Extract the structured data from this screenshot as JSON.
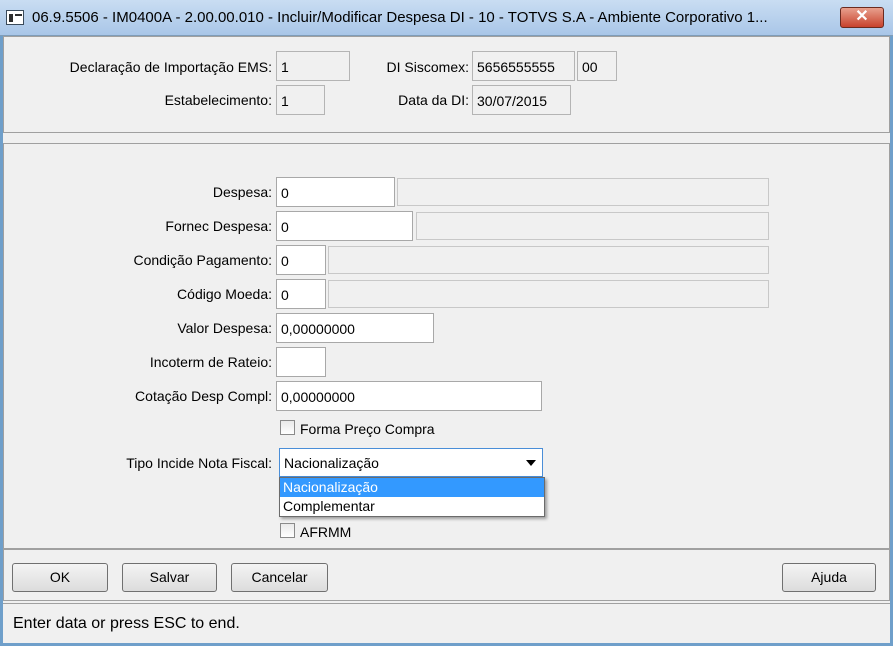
{
  "window": {
    "title": "06.9.5506 - IM0400A - 2.00.00.010 - Incluir/Modificar Despesa DI - 10 - TOTVS S.A - Ambiente Corporativo 1...",
    "close_label": "✕"
  },
  "header": {
    "declaracao_label": "Declaração de Importação EMS:",
    "declaracao_value": "1",
    "di_siscomex_label": "DI Siscomex:",
    "di_siscomex_value": "5656555555",
    "di_siscomex_suffix": "00",
    "estabelecimento_label": "Estabelecimento:",
    "estabelecimento_value": "1",
    "data_di_label": "Data da DI:",
    "data_di_value": "30/07/2015"
  },
  "form": {
    "despesa_label": "Despesa:",
    "despesa_value": "0",
    "despesa_desc": "",
    "fornec_label": "Fornec Despesa:",
    "fornec_value": "0",
    "fornec_desc": "",
    "condicao_label": "Condição Pagamento:",
    "condicao_value": "0",
    "condicao_desc": "",
    "moeda_label": "Código Moeda:",
    "moeda_value": "0",
    "moeda_desc": "",
    "valor_label": "Valor Despesa:",
    "valor_value": "0,00000000",
    "incoterm_label": "Incoterm de Rateio:",
    "incoterm_value": "",
    "cotacao_label": "Cotação Desp Compl:",
    "cotacao_value": "0,00000000",
    "forma_preco_label": "Forma Preço Compra",
    "forma_preco_checked": false,
    "tipo_incide_label": "Tipo Incide Nota Fiscal:",
    "tipo_incide_value": "Nacionalização",
    "tipo_incide_options": [
      "Nacionalização",
      "Complementar"
    ],
    "afrmm_label": "AFRMM",
    "afrmm_checked": false
  },
  "buttons": {
    "ok": "OK",
    "salvar": "Salvar",
    "cancelar": "Cancelar",
    "ajuda": "Ajuda"
  },
  "status": {
    "text": "Enter data or press ESC to end."
  },
  "colors": {
    "title_gradient_top": "#c9ddf2",
    "selection": "#3399ff",
    "close_button": "#c8422c"
  }
}
